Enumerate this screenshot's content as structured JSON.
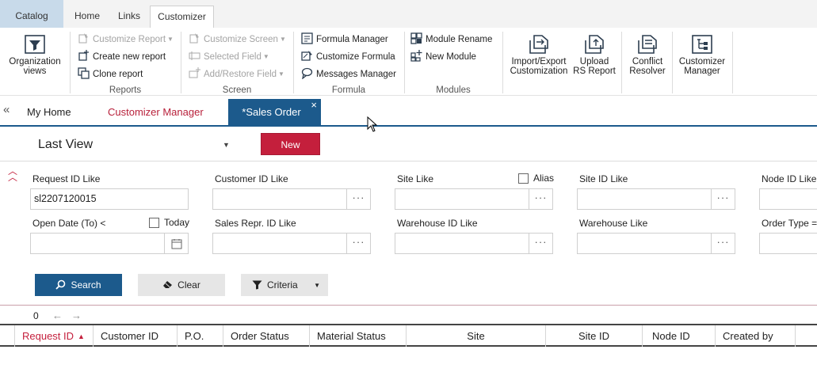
{
  "ribbon_tabs": {
    "catalog": "Catalog",
    "home": "Home",
    "links": "Links",
    "customizer": "Customizer"
  },
  "ribbon": {
    "org_views": {
      "line1": "Organization",
      "line2": "views"
    },
    "reports": {
      "caption": "Reports",
      "customize_report": "Customize Report",
      "create_new_report": "Create new report",
      "clone_report": "Clone report"
    },
    "screen": {
      "caption": "Screen",
      "customize_screen": "Customize Screen",
      "selected_field": "Selected Field",
      "add_restore_field": "Add/Restore Field"
    },
    "formula": {
      "caption": "Formula",
      "formula_manager": "Formula Manager",
      "customize_formula": "Customize Formula",
      "messages_manager": "Messages Manager"
    },
    "modules": {
      "caption": "Modules",
      "module_rename": "Module Rename",
      "new_module": "New Module"
    },
    "import_export": {
      "line1": "Import/Export",
      "line2": "Customization"
    },
    "upload_rs": {
      "line1": "Upload",
      "line2": "RS Report"
    },
    "conflict": {
      "line1": "Conflict",
      "line2": "Resolver"
    },
    "cust_manager": {
      "line1": "Customizer",
      "line2": "Manager"
    }
  },
  "doc_tabs": {
    "collapse": "«",
    "my_home": "My Home",
    "customizer_manager": "Customizer Manager",
    "sales_order": "*Sales Order",
    "close": "×"
  },
  "view": {
    "name": "Last View",
    "new_button": "New"
  },
  "filters": {
    "request_id": {
      "label": "Request ID  Like",
      "value": "sl2207120015"
    },
    "customer_id": {
      "label": "Customer ID  Like",
      "value": ""
    },
    "site": {
      "label": "Site  Like",
      "value": "",
      "alias_label": "Alias"
    },
    "site_id": {
      "label": "Site ID  Like",
      "value": ""
    },
    "node_id": {
      "label": "Node ID  Like",
      "value": ""
    },
    "open_date": {
      "label": "Open Date (To)  <",
      "value": "",
      "today_label": "Today"
    },
    "sales_repr": {
      "label": "Sales Repr. ID  Like",
      "value": ""
    },
    "warehouse_id": {
      "label": "Warehouse ID  Like",
      "value": ""
    },
    "warehouse": {
      "label": "Warehouse  Like",
      "value": ""
    },
    "order_type": {
      "label": "Order Type  =",
      "value": ""
    },
    "ellipsis": "···"
  },
  "actions": {
    "search": "Search",
    "clear": "Clear",
    "criteria": "Criteria"
  },
  "pager": {
    "count": "0",
    "prev": "←",
    "next": "→"
  },
  "grid": {
    "columns": [
      {
        "label": "Request ID"
      },
      {
        "label": "Customer ID"
      },
      {
        "label": "P.O."
      },
      {
        "label": "Order Status"
      },
      {
        "label": "Material Status"
      },
      {
        "label": "Site"
      },
      {
        "label": "Site ID"
      },
      {
        "label": "Node ID"
      },
      {
        "label": "Created by"
      }
    ]
  },
  "colors": {
    "accent_blue": "#1c5a8c",
    "accent_red": "#c41f3c",
    "catalog_tab": "#c8daea"
  }
}
